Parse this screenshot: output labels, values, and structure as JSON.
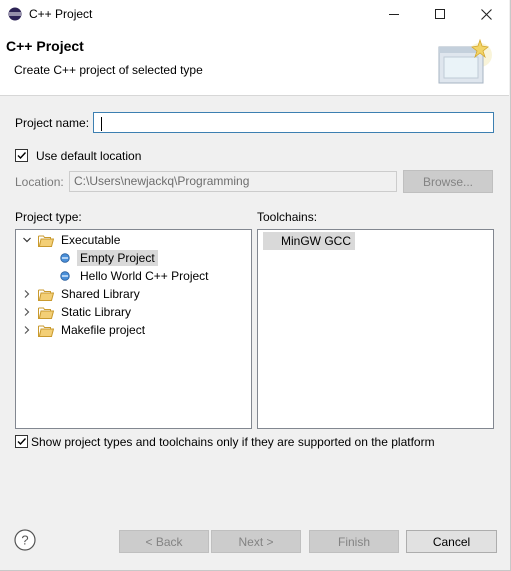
{
  "window": {
    "title": "C++ Project"
  },
  "header": {
    "title": "C++ Project",
    "description": "Create C++ project of selected type"
  },
  "form": {
    "project_name_label": "Project name:",
    "project_name_value": "",
    "use_default_location_label": "Use default location",
    "use_default_location_checked": true,
    "location_label": "Location:",
    "location_value": "C:\\Users\\newjackq\\Programming",
    "browse_label": "Browse..."
  },
  "project_type": {
    "label": "Project type:",
    "tree": [
      {
        "label": "Executable",
        "expanded": true,
        "children": [
          {
            "label": "Empty Project",
            "selected": true
          },
          {
            "label": "Hello World C++ Project",
            "selected": false
          }
        ]
      },
      {
        "label": "Shared Library",
        "expanded": false
      },
      {
        "label": "Static Library",
        "expanded": false
      },
      {
        "label": "Makefile project",
        "expanded": false
      }
    ]
  },
  "toolchains": {
    "label": "Toolchains:",
    "items": [
      {
        "label": "MinGW GCC",
        "selected": true
      }
    ]
  },
  "filter": {
    "label": "Show project types and toolchains only if they are supported on the platform",
    "checked": true
  },
  "buttons": {
    "back": "< Back",
    "next": "Next >",
    "finish": "Finish",
    "cancel": "Cancel"
  },
  "icons": {
    "app": "eclipse-icon",
    "minimize": "minimize-icon",
    "maximize": "maximize-icon",
    "close": "close-icon",
    "wizard": "new-project-wizard-icon",
    "help": "help-icon",
    "folder": "folder-icon",
    "project_template": "project-template-icon"
  },
  "colors": {
    "focus_border": "#3c7fb1",
    "selection": "#d9d9d9",
    "folder": "#e8b84a"
  }
}
